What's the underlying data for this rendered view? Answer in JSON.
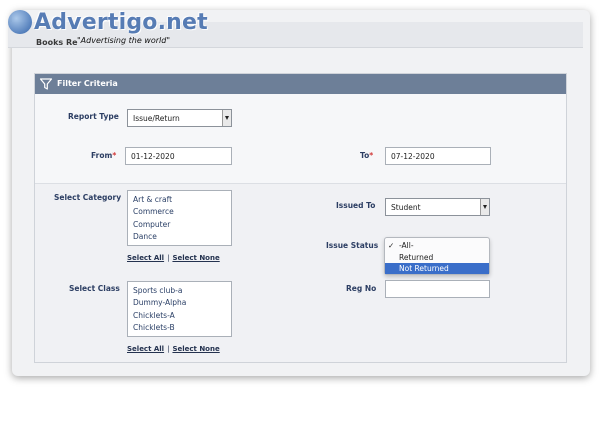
{
  "watermark": {
    "brand": "Advertigo.net",
    "slogan": "\"Advertising the world\""
  },
  "window": {
    "title": "Books Re"
  },
  "panel": {
    "title": "Filter Criteria"
  },
  "filters": {
    "report_type": {
      "label": "Report Type",
      "value": "Issue/Return"
    },
    "from": {
      "label": "From",
      "required_mark": "*",
      "value": "01-12-2020"
    },
    "to": {
      "label": "To",
      "required_mark": "*",
      "value": "07-12-2020"
    },
    "select_category": {
      "label": "Select Category",
      "options": [
        "Art & craft",
        "Commerce",
        "Computer",
        "Dance"
      ],
      "select_all": "Select All",
      "separator": "|",
      "select_none": "Select None"
    },
    "issued_to": {
      "label": "Issued To",
      "value": "Student"
    },
    "issue_status": {
      "label": "Issue Status",
      "checkmark": "✓",
      "options": [
        "-All-",
        "Returned",
        "Not Returned"
      ],
      "checked": "-All-",
      "highlighted": "Not Returned"
    },
    "select_class": {
      "label": "Select Class",
      "options": [
        "Sports club-a",
        "Dummy-Alpha",
        "Chicklets-A",
        "Chicklets-B"
      ],
      "select_all": "Select All",
      "separator": "|",
      "select_none": "Select None"
    },
    "reg_no": {
      "label": "Reg No",
      "value": ""
    }
  },
  "colors": {
    "header": "#6d7f98",
    "label": "#2c3e63",
    "required": "#d23a3a",
    "highlight": "#3a6ec9"
  },
  "icons": {
    "filter": "filter-funnel-icon",
    "globe": "globe-icon"
  }
}
